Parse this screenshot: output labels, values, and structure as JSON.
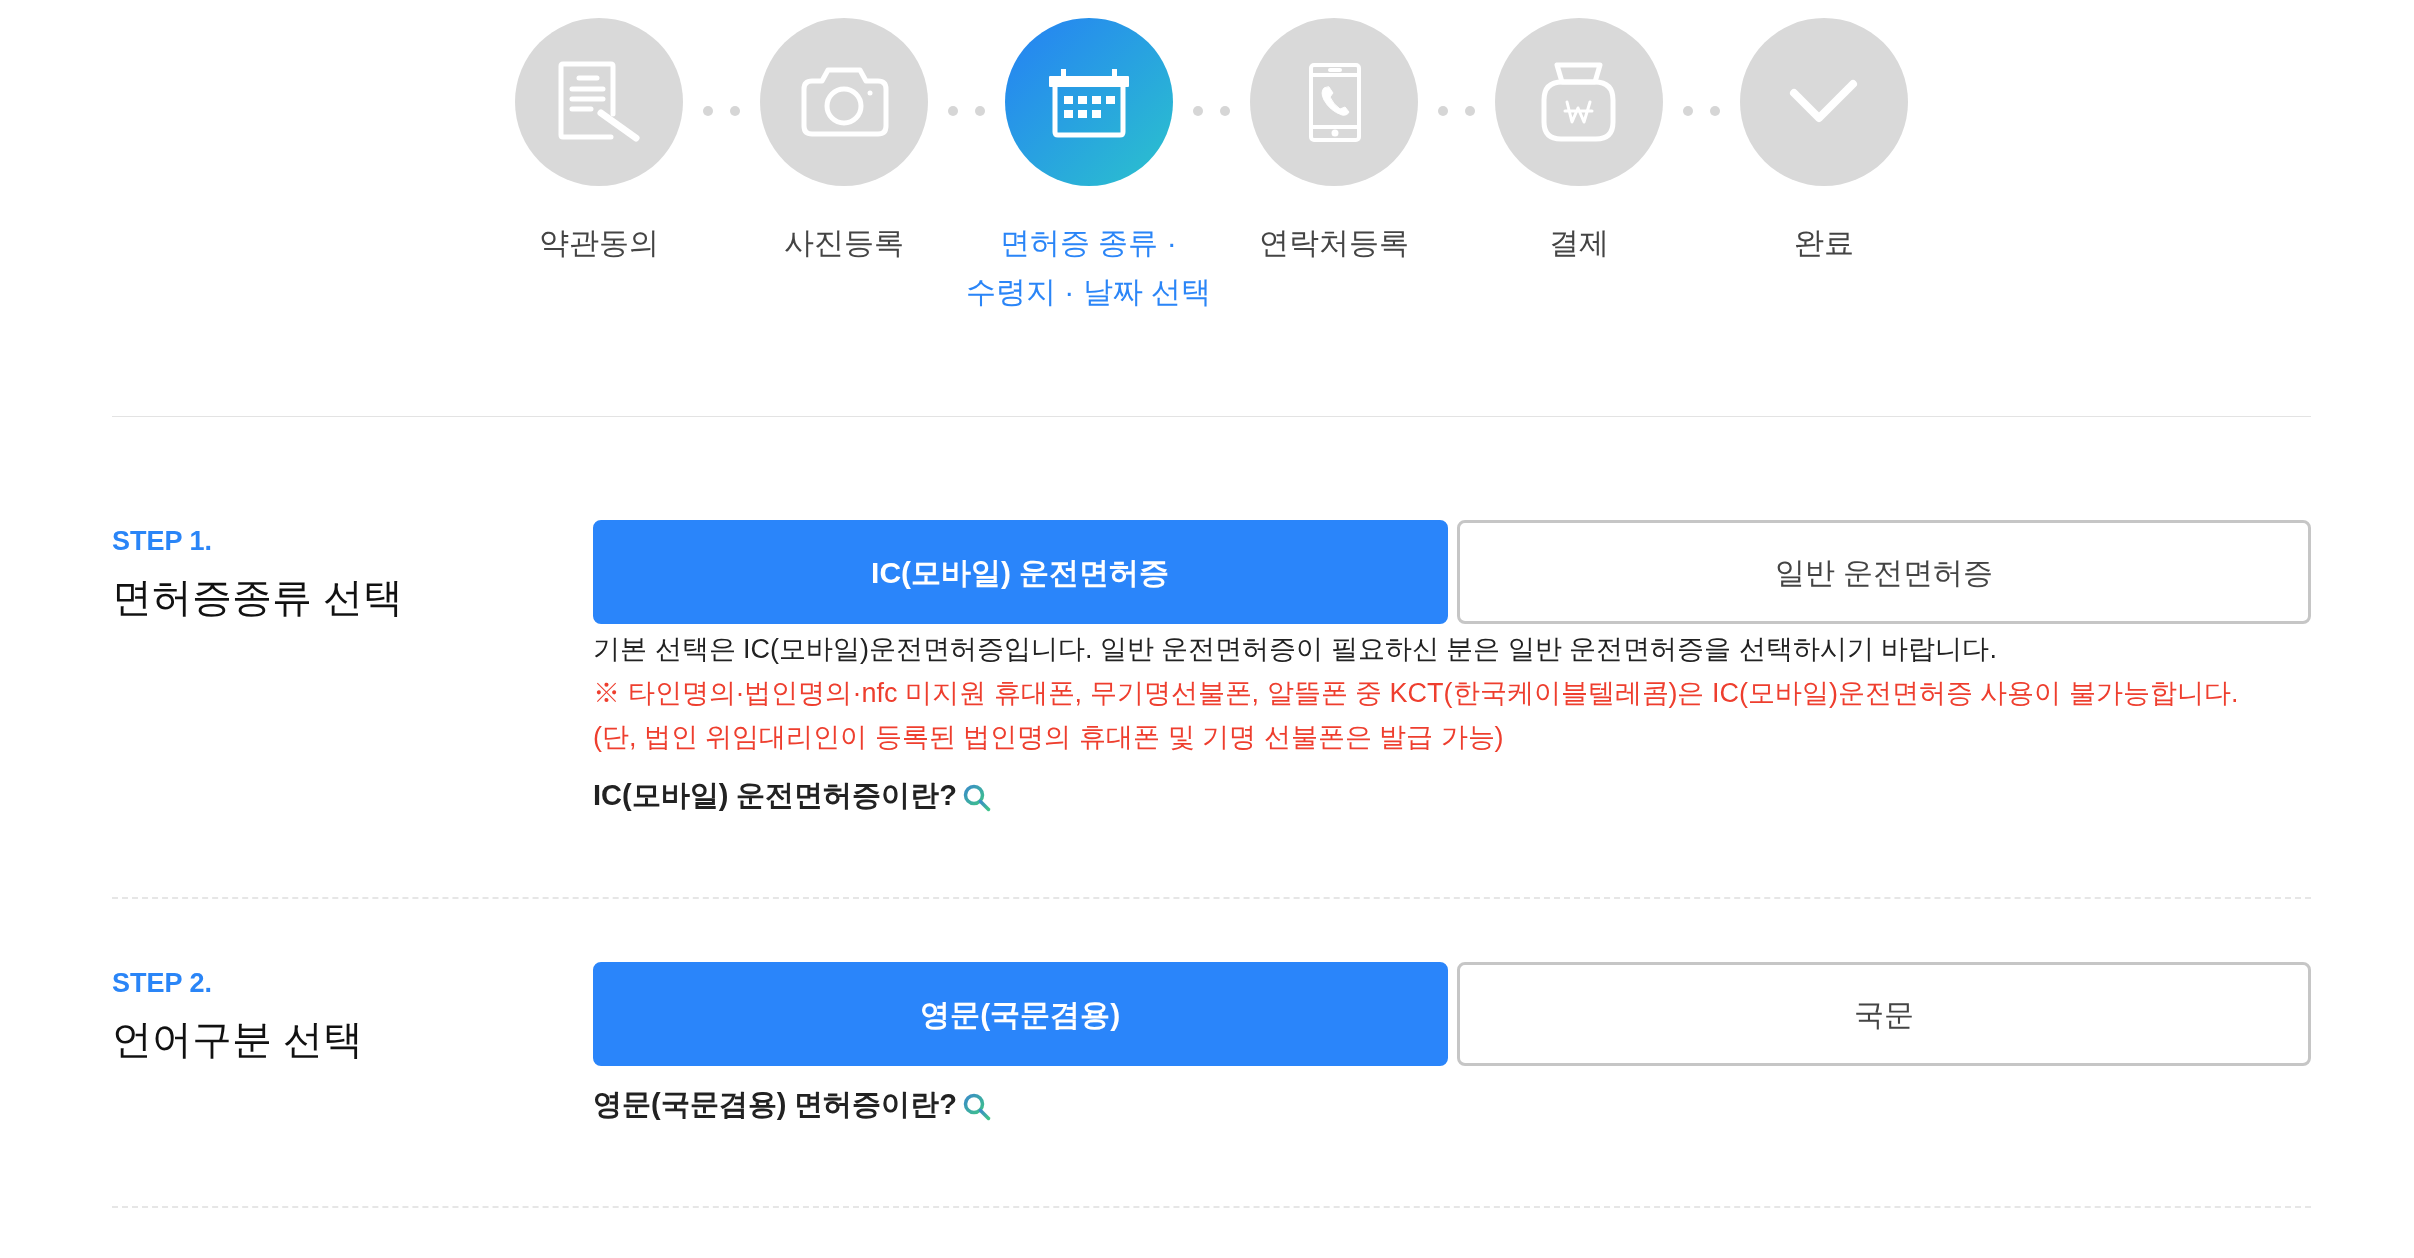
{
  "progress_steps": [
    {
      "label": "약관동의",
      "selected": false
    },
    {
      "label": "사진등록",
      "selected": false
    },
    {
      "label": "면허증 종류 · 수령지 · 날짜 선택",
      "selected": true
    },
    {
      "label": "연락처등록",
      "selected": false
    },
    {
      "label": "결제",
      "selected": false
    },
    {
      "label": "완료",
      "selected": false
    }
  ],
  "sections": [
    {
      "step": "STEP 1.",
      "title": "면허증종류 선택",
      "options": [
        {
          "label": "IC(모바일) 운전면허증",
          "selected": true
        },
        {
          "label": "일반 운전면허증",
          "selected": false
        }
      ],
      "description": "기본 선택은 IC(모바일)운전면허증입니다. 일반 운전면허증이 필요하신 분은 일반 운전면허증을 선택하시기 바랍니다.",
      "notes": [
        "※ 타인명의·법인명의·nfc 미지원 휴대폰, 무기명선불폰, 알뜰폰 중 KCT(한국케이블텔레콤)은 IC(모바일)운전면허증 사용이 불가능합니다.",
        "(단, 법인 위임대리인이 등록된 법인명의 휴대폰 및 기명 선불폰은 발급 가능)"
      ],
      "info_link": "IC(모바일) 운전면허증이란?"
    },
    {
      "step": "STEP 2.",
      "title": "언어구분 선택",
      "options": [
        {
          "label": "영문(국문겸용)",
          "selected": true
        },
        {
          "label": "국문",
          "selected": false
        }
      ],
      "info_link": "영문(국문겸용) 면허증이란?"
    }
  ]
}
